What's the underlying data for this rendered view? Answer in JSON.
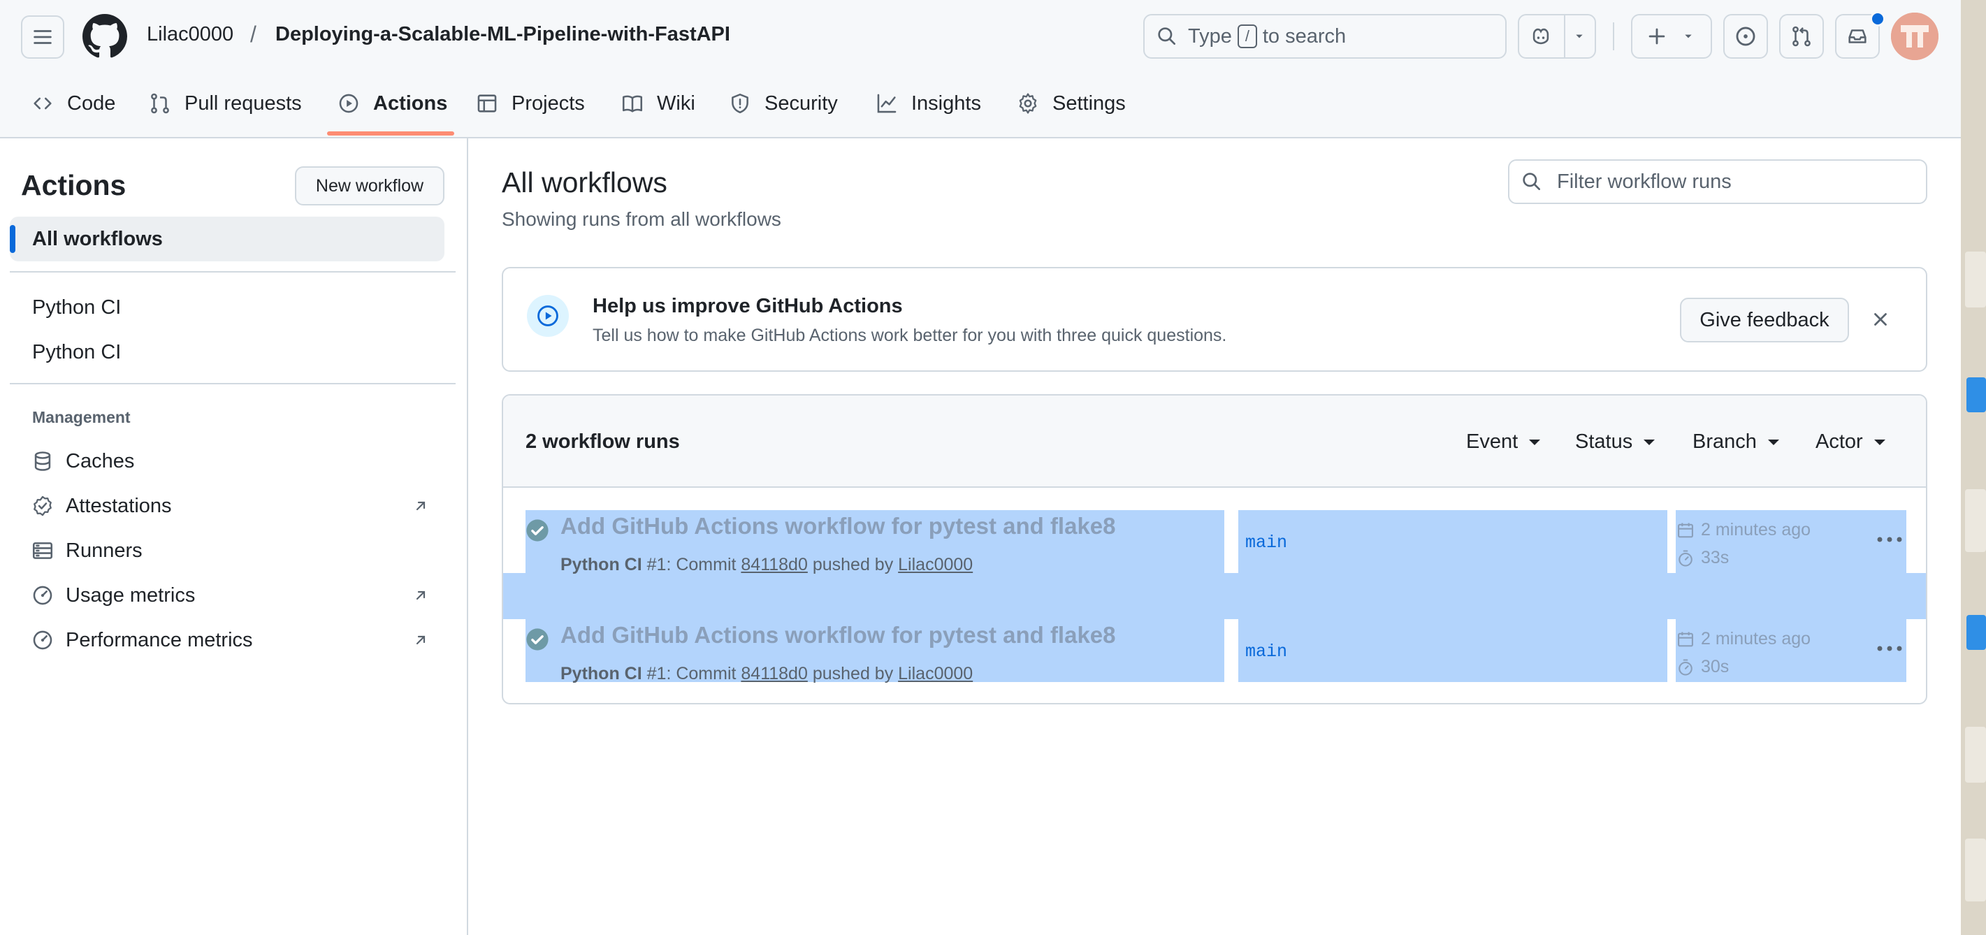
{
  "header": {
    "owner": "Lilac0000",
    "separator": "/",
    "repo": "Deploying-a-Scalable-ML-Pipeline-with-FastAPI",
    "search": {
      "prefix": "Type",
      "key": "/",
      "suffix": "to search"
    }
  },
  "repo_nav": {
    "tabs": [
      {
        "label": "Code",
        "icon": "code-icon"
      },
      {
        "label": "Pull requests",
        "icon": "pull-request-icon"
      },
      {
        "label": "Actions",
        "icon": "play-icon",
        "active": true
      },
      {
        "label": "Projects",
        "icon": "table-icon"
      },
      {
        "label": "Wiki",
        "icon": "book-icon"
      },
      {
        "label": "Security",
        "icon": "shield-icon"
      },
      {
        "label": "Insights",
        "icon": "graph-icon"
      },
      {
        "label": "Settings",
        "icon": "gear-icon"
      }
    ]
  },
  "sidebar": {
    "title": "Actions",
    "new_workflow_label": "New workflow",
    "all_workflows_label": "All workflows",
    "workflows": [
      "Python CI",
      "Python CI"
    ],
    "management_heading": "Management",
    "management_items": [
      {
        "label": "Caches",
        "icon": "database-icon",
        "external": false
      },
      {
        "label": "Attestations",
        "icon": "verified-icon",
        "external": true
      },
      {
        "label": "Runners",
        "icon": "server-icon",
        "external": false
      },
      {
        "label": "Usage metrics",
        "icon": "meter-icon",
        "external": true
      },
      {
        "label": "Performance metrics",
        "icon": "meter-icon",
        "external": true
      }
    ]
  },
  "main": {
    "title": "All workflows",
    "subtitle": "Showing runs from all workflows",
    "filter_placeholder": "Filter workflow runs",
    "banner": {
      "title": "Help us improve GitHub Actions",
      "text": "Tell us how to make GitHub Actions work better for you with three quick questions.",
      "button_label": "Give feedback"
    },
    "runs": {
      "count_label": "2 workflow runs",
      "filters": [
        "Event",
        "Status",
        "Branch",
        "Actor"
      ],
      "items": [
        {
          "title": "Add GitHub Actions workflow for pytest and flake8",
          "workflow": "Python CI",
          "run_number": "#1",
          "commit_prefix": ": Commit",
          "commit": "84118d0",
          "pushed_by": "pushed by",
          "actor": "Lilac0000",
          "branch": "main",
          "time": "2 minutes ago",
          "duration": "33s",
          "status": "success"
        },
        {
          "title": "Add GitHub Actions workflow for pytest and flake8",
          "workflow": "Python CI",
          "run_number": "#1",
          "commit_prefix": ": Commit",
          "commit": "84118d0",
          "pushed_by": "pushed by",
          "actor": "Lilac0000",
          "branch": "main",
          "time": "2 minutes ago",
          "duration": "30s",
          "status": "success"
        }
      ]
    }
  },
  "colors": {
    "accent": "#0969da",
    "active_tab_underline": "#fd8c73",
    "selection": "#b3d4fc",
    "success": "#1a7f37"
  }
}
